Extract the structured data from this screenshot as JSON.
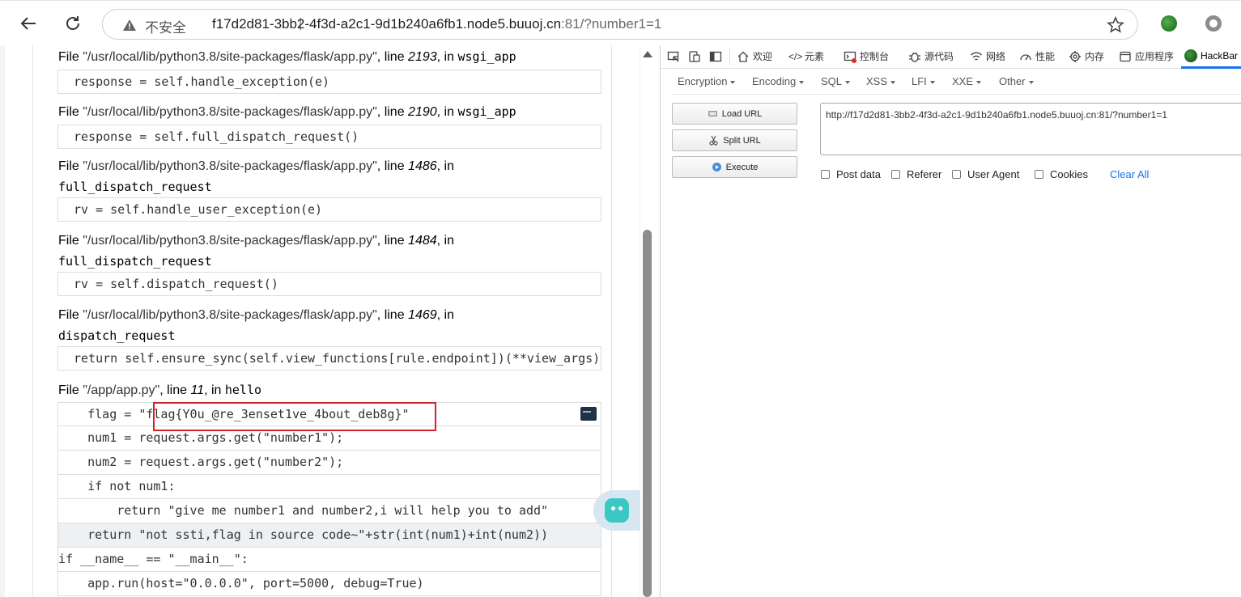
{
  "browser": {
    "security_label": "不安全",
    "separator": "|",
    "url_host": "f17d2d81-3bb2-4f3d-a2c1-9d1b240a6fb1.node5.buuoj.cn",
    "url_rest": ":81/?number1=1"
  },
  "traceback": {
    "frames": [
      {
        "file_prefix": "File ",
        "path": "\"/usr/local/lib/python3.8/site-packages/flask/app.py\"",
        "line_prefix": ", line ",
        "line": "2193",
        "in_prefix": ", in ",
        "func": "wsgi_app",
        "code": "response = self.handle_exception(e)"
      },
      {
        "file_prefix": "File ",
        "path": "\"/usr/local/lib/python3.8/site-packages/flask/app.py\"",
        "line_prefix": ", line ",
        "line": "2190",
        "in_prefix": ", in ",
        "func": "wsgi_app",
        "code": "response = self.full_dispatch_request()"
      },
      {
        "file_prefix": "File ",
        "path": "\"/usr/local/lib/python3.8/site-packages/flask/app.py\"",
        "line_prefix": ", line ",
        "line": "1486",
        "in_prefix": ", in",
        "func": "full_dispatch_request",
        "code": "rv = self.handle_user_exception(e)"
      },
      {
        "file_prefix": "File ",
        "path": "\"/usr/local/lib/python3.8/site-packages/flask/app.py\"",
        "line_prefix": ", line ",
        "line": "1484",
        "in_prefix": ", in",
        "func": "full_dispatch_request",
        "code": "rv = self.dispatch_request()"
      },
      {
        "file_prefix": "File ",
        "path": "\"/usr/local/lib/python3.8/site-packages/flask/app.py\"",
        "line_prefix": ", line ",
        "line": "1469",
        "in_prefix": ", in",
        "func": "dispatch_request",
        "code": "return self.ensure_sync(self.view_functions[rule.endpoint])(**view_args)"
      },
      {
        "file_prefix": "File ",
        "path": "\"/app/app.py\"",
        "line_prefix": ", line ",
        "line": "11",
        "in_prefix": ", in ",
        "func": "hello"
      }
    ],
    "source_lines": [
      "    flag = \"flag{Y0u_@re_3enset1ve_4bout_deb8g}\"",
      "    num1 = request.args.get(\"number1\");",
      "    num2 = request.args.get(\"number2\");",
      "    if not num1:",
      "        return \"give me number1 and number2,i will help you to add\"",
      "    return \"not ssti,flag in source code~\"+str(int(num1)+int(num2))",
      "if __name__ == \"__main__\":",
      "    app.run(host=\"0.0.0.0\", port=5000, debug=True)"
    ]
  },
  "devtools": {
    "tabs": [
      "欢迎",
      "元素",
      "控制台",
      "源代码",
      "网络",
      "性能",
      "内存",
      "应用程序",
      "HackBar"
    ],
    "hackbar": {
      "menu": [
        "Encryption",
        "Encoding",
        "SQL",
        "XSS",
        "LFI",
        "XXE",
        "Other"
      ],
      "buttons": {
        "load": "Load URL",
        "split": "Split URL",
        "execute": "Execute"
      },
      "url_value": "http://f17d2d81-3bb2-4f3d-a2c1-9d1b240a6fb1.node5.buuoj.cn:81/?number1=1",
      "checks": [
        "Post data",
        "Referer",
        "User Agent",
        "Cookies"
      ],
      "clear_all": "Clear All"
    }
  },
  "colors": {
    "accent": "#1a73e8",
    "highlight_border": "#d0242b",
    "current_line": "#edf1f3"
  }
}
